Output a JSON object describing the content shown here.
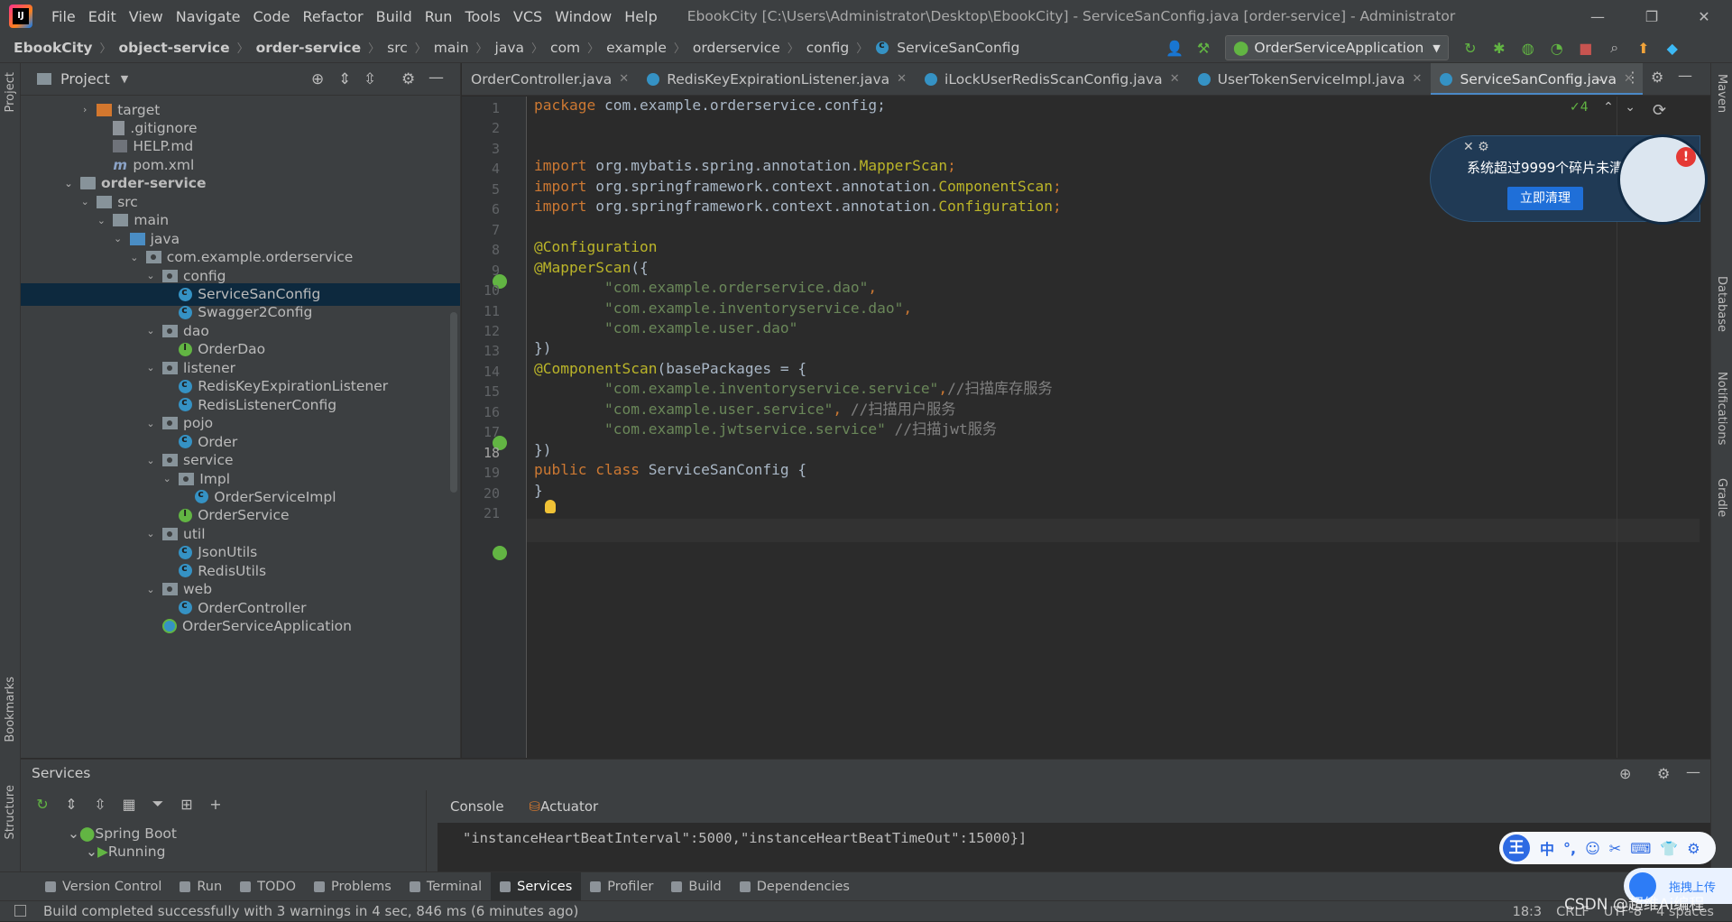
{
  "titlebar": {
    "menu": [
      "File",
      "Edit",
      "View",
      "Navigate",
      "Code",
      "Refactor",
      "Build",
      "Run",
      "Tools",
      "VCS",
      "Window",
      "Help"
    ],
    "window_title": "EbookCity [C:\\Users\\Administrator\\Desktop\\EbookCity] - ServiceSanConfig.java [order-service] - Administrator",
    "minimize": "—",
    "restore": "❐",
    "close": "✕"
  },
  "navbar": {
    "crumbs": [
      "EbookCity",
      "object-service",
      "order-service",
      "src",
      "main",
      "java",
      "com",
      "example",
      "orderservice",
      "config",
      "ServiceSanConfig"
    ],
    "run_config": "OrderServiceApplication"
  },
  "left_strip": {
    "project": "Project",
    "bookmarks": "Bookmarks",
    "structure": "Structure"
  },
  "right_strip": {
    "maven": "Maven",
    "database": "Database",
    "notifications": "Notifications",
    "gradle": "Gradle"
  },
  "project_panel": {
    "title": "Project",
    "tree": [
      {
        "label": "target",
        "indent": 1,
        "arrow": "›",
        "icon": "folder-orange"
      },
      {
        "label": ".gitignore",
        "indent": 2,
        "arrow": "",
        "icon": "file"
      },
      {
        "label": "HELP.md",
        "indent": 2,
        "arrow": "",
        "icon": "md"
      },
      {
        "label": "pom.xml",
        "indent": 2,
        "arrow": "",
        "icon": "maven"
      },
      {
        "label": "order-service",
        "indent": 0,
        "arrow": "⌄",
        "icon": "folder",
        "bold": true
      },
      {
        "label": "src",
        "indent": 1,
        "arrow": "⌄",
        "icon": "folder-src"
      },
      {
        "label": "main",
        "indent": 2,
        "arrow": "⌄",
        "icon": "folder-src"
      },
      {
        "label": "java",
        "indent": 3,
        "arrow": "⌄",
        "icon": "folder-blue"
      },
      {
        "label": "com.example.orderservice",
        "indent": 4,
        "arrow": "⌄",
        "icon": "pkg"
      },
      {
        "label": "config",
        "indent": 5,
        "arrow": "⌄",
        "icon": "pkg"
      },
      {
        "label": "ServiceSanConfig",
        "indent": 6,
        "arrow": "",
        "icon": "cls",
        "selected": true
      },
      {
        "label": "Swagger2Config",
        "indent": 6,
        "arrow": "",
        "icon": "cls"
      },
      {
        "label": "dao",
        "indent": 5,
        "arrow": "⌄",
        "icon": "pkg"
      },
      {
        "label": "OrderDao",
        "indent": 6,
        "arrow": "",
        "icon": "intf"
      },
      {
        "label": "listener",
        "indent": 5,
        "arrow": "⌄",
        "icon": "pkg"
      },
      {
        "label": "RedisKeyExpirationListener",
        "indent": 6,
        "arrow": "",
        "icon": "cls"
      },
      {
        "label": "RedisListenerConfig",
        "indent": 6,
        "arrow": "",
        "icon": "cls"
      },
      {
        "label": "pojo",
        "indent": 5,
        "arrow": "⌄",
        "icon": "pkg"
      },
      {
        "label": "Order",
        "indent": 6,
        "arrow": "",
        "icon": "cls"
      },
      {
        "label": "service",
        "indent": 5,
        "arrow": "⌄",
        "icon": "pkg"
      },
      {
        "label": "Impl",
        "indent": 6,
        "arrow": "⌄",
        "icon": "pkg"
      },
      {
        "label": "OrderServiceImpl",
        "indent": 7,
        "arrow": "",
        "icon": "cls"
      },
      {
        "label": "OrderService",
        "indent": 6,
        "arrow": "",
        "icon": "intf"
      },
      {
        "label": "util",
        "indent": 5,
        "arrow": "⌄",
        "icon": "pkg"
      },
      {
        "label": "JsonUtils",
        "indent": 6,
        "arrow": "",
        "icon": "cls"
      },
      {
        "label": "RedisUtils",
        "indent": 6,
        "arrow": "",
        "icon": "cls"
      },
      {
        "label": "web",
        "indent": 5,
        "arrow": "⌄",
        "icon": "pkg"
      },
      {
        "label": "OrderController",
        "indent": 6,
        "arrow": "",
        "icon": "cls"
      },
      {
        "label": "OrderServiceApplication",
        "indent": 5,
        "arrow": "",
        "icon": "app"
      }
    ]
  },
  "tabs": [
    {
      "label": "OrderController.java",
      "active": false
    },
    {
      "label": "RedisKeyExpirationListener.java",
      "active": false
    },
    {
      "label": "iLockUserRedisScanConfig.java",
      "active": false
    },
    {
      "label": "UserTokenServiceImpl.java",
      "active": false
    },
    {
      "label": "ServiceSanConfig.java",
      "active": true
    }
  ],
  "editor": {
    "inspections": "✓4",
    "current_line": 18,
    "lines": [
      [
        [
          "kw",
          "package "
        ],
        [
          "",
          "com.example.orderservice.config;"
        ]
      ],
      [],
      [],
      [
        [
          "kw",
          "import "
        ],
        [
          "",
          "org.mybatis.spring.annotation."
        ],
        [
          "ann",
          "MapperScan"
        ],
        [
          "kw",
          ";"
        ]
      ],
      [
        [
          "kw",
          "import "
        ],
        [
          "",
          "org.springframework.context.annotation."
        ],
        [
          "ann",
          "ComponentScan"
        ],
        [
          "kw",
          ";"
        ]
      ],
      [
        [
          "kw",
          "import "
        ],
        [
          "",
          "org.springframework.context.annotation."
        ],
        [
          "ann",
          "Configuration"
        ],
        [
          "kw",
          ";"
        ]
      ],
      [],
      [
        [
          "ann",
          "@Configuration"
        ]
      ],
      [
        [
          "ann",
          "@MapperScan"
        ],
        [
          "",
          "({"
        ]
      ],
      [
        [
          "",
          "        "
        ],
        [
          "str",
          "\"com.example.orderservice.dao\""
        ],
        [
          "kw",
          ","
        ]
      ],
      [
        [
          "",
          "        "
        ],
        [
          "str",
          "\"com.example.inventoryservice.dao\""
        ],
        [
          "kw",
          ","
        ]
      ],
      [
        [
          "",
          "        "
        ],
        [
          "str",
          "\"com.example.user.dao\""
        ]
      ],
      [
        [
          "",
          "})"
        ]
      ],
      [
        [
          "ann",
          "@ComponentScan"
        ],
        [
          "",
          "(basePackages = {"
        ]
      ],
      [
        [
          "",
          "        "
        ],
        [
          "str",
          "\"com.example.inventoryservice.service\""
        ],
        [
          "kw",
          ","
        ],
        [
          "cmt",
          "//扫描库存服务"
        ]
      ],
      [
        [
          "",
          "        "
        ],
        [
          "str",
          "\"com.example.user.service\""
        ],
        [
          "kw",
          ", "
        ],
        [
          "cmt",
          "//扫描用户服务"
        ]
      ],
      [
        [
          "",
          "        "
        ],
        [
          "str",
          "\"com.example.jwtservice.service\""
        ],
        [
          "",
          " "
        ],
        [
          "cmt",
          "//扫描jwt服务"
        ]
      ],
      [
        [
          "",
          "})"
        ]
      ],
      [
        [
          "kw",
          "public class "
        ],
        [
          "",
          "ServiceSanConfig {"
        ]
      ],
      [
        [
          "",
          "}"
        ]
      ],
      []
    ]
  },
  "popup": {
    "text": "系统超过9999个碎片未清理",
    "button": "立即清理",
    "badge": "!",
    "close": "✕ ⚙"
  },
  "services": {
    "title": "Services",
    "tree": [
      {
        "label": "Spring Boot",
        "arrow": "⌄"
      },
      {
        "label": "Running",
        "arrow": "⌄"
      }
    ],
    "tabs": [
      "Console",
      "Actuator"
    ],
    "console_text": "\"instanceHeartBeatInterval\":5000,\"instanceHeartBeatTimeOut\":15000}]"
  },
  "bottom_tools": [
    {
      "label": "Version Control",
      "active": false
    },
    {
      "label": "Run",
      "active": false
    },
    {
      "label": "TODO",
      "active": false
    },
    {
      "label": "Problems",
      "active": false
    },
    {
      "label": "Terminal",
      "active": false
    },
    {
      "label": "Services",
      "active": true
    },
    {
      "label": "Profiler",
      "active": false
    },
    {
      "label": "Build",
      "active": false
    },
    {
      "label": "Dependencies",
      "active": false
    }
  ],
  "statusbar": {
    "message": "Build completed successfully with 3 warnings in 4 sec, 846 ms (6 minutes ago)",
    "position": "18:3",
    "line_sep": "CRLF",
    "encoding": "UTF-8",
    "indent": "4 spaces"
  },
  "ime": {
    "logo": "王",
    "items": [
      "中",
      "°,",
      "☺",
      "✂",
      "⌨",
      "👕",
      "⚙"
    ]
  },
  "baidu": {
    "label": "拖拽上传"
  },
  "watermark": "CSDN @超维Ai编程"
}
